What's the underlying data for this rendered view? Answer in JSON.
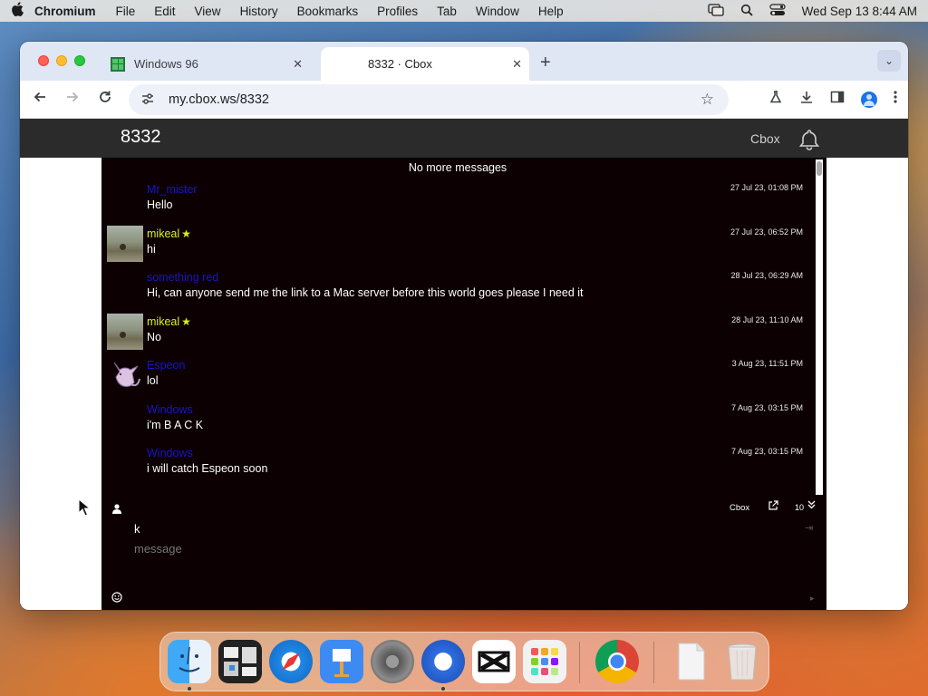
{
  "menubar": {
    "app_name": "Chromium",
    "menus": [
      "File",
      "Edit",
      "View",
      "History",
      "Bookmarks",
      "Profiles",
      "Tab",
      "Window",
      "Help"
    ],
    "datetime": "Wed Sep 13  8:44 AM"
  },
  "browser": {
    "tabs": [
      {
        "title": "Windows 96",
        "active": false
      },
      {
        "title": "8332 · Cbox",
        "active": true
      }
    ],
    "url": "my.cbox.ws/8332"
  },
  "site": {
    "title": "8332",
    "brand": "Cbox"
  },
  "chat": {
    "no_more_label": "No more messages",
    "messages": [
      {
        "user": "Mr_mister",
        "registered": false,
        "avatar": "none",
        "text": "Hello",
        "time": "27 Jul 23, 01:08 PM"
      },
      {
        "user": "mikeal",
        "registered": true,
        "avatar": "photo",
        "text": "hi",
        "time": "27 Jul 23, 06:52 PM"
      },
      {
        "user": "something red",
        "registered": false,
        "avatar": "none",
        "text": "Hi, can anyone send me the link to a Mac server before this world goes please I need it",
        "time": "28 Jul 23, 06:29 AM"
      },
      {
        "user": "mikeal",
        "registered": true,
        "avatar": "photo",
        "text": "No",
        "time": "28 Jul 23, 11:10 AM"
      },
      {
        "user": "Espeon",
        "registered": false,
        "avatar": "espeon",
        "text": "lol",
        "time": "3 Aug 23, 11:51 PM"
      },
      {
        "user": "Windows",
        "registered": false,
        "avatar": "none",
        "text": "i'm B A C K",
        "time": "7 Aug 23, 03:15 PM"
      },
      {
        "user": "Windows",
        "registered": false,
        "avatar": "none",
        "text": "i will catch Espeon soon",
        "time": "7 Aug 23, 03:15 PM"
      }
    ],
    "composer": {
      "brand_link": "Cbox",
      "count": "10",
      "name_value": "k",
      "message_placeholder": "message"
    }
  },
  "colors": {
    "chat_bg": "#0c0002",
    "guest_name": "#1a14c8",
    "registered_name": "#d9f20e",
    "header_bg": "#2b2b2b"
  },
  "icons": [
    "apple-icon",
    "windows-favicon",
    "cbox-favicon",
    "bell-icon",
    "user-icon",
    "popout-icon",
    "chevron-double-down-icon",
    "emoji-icon",
    "star-badge-icon"
  ]
}
